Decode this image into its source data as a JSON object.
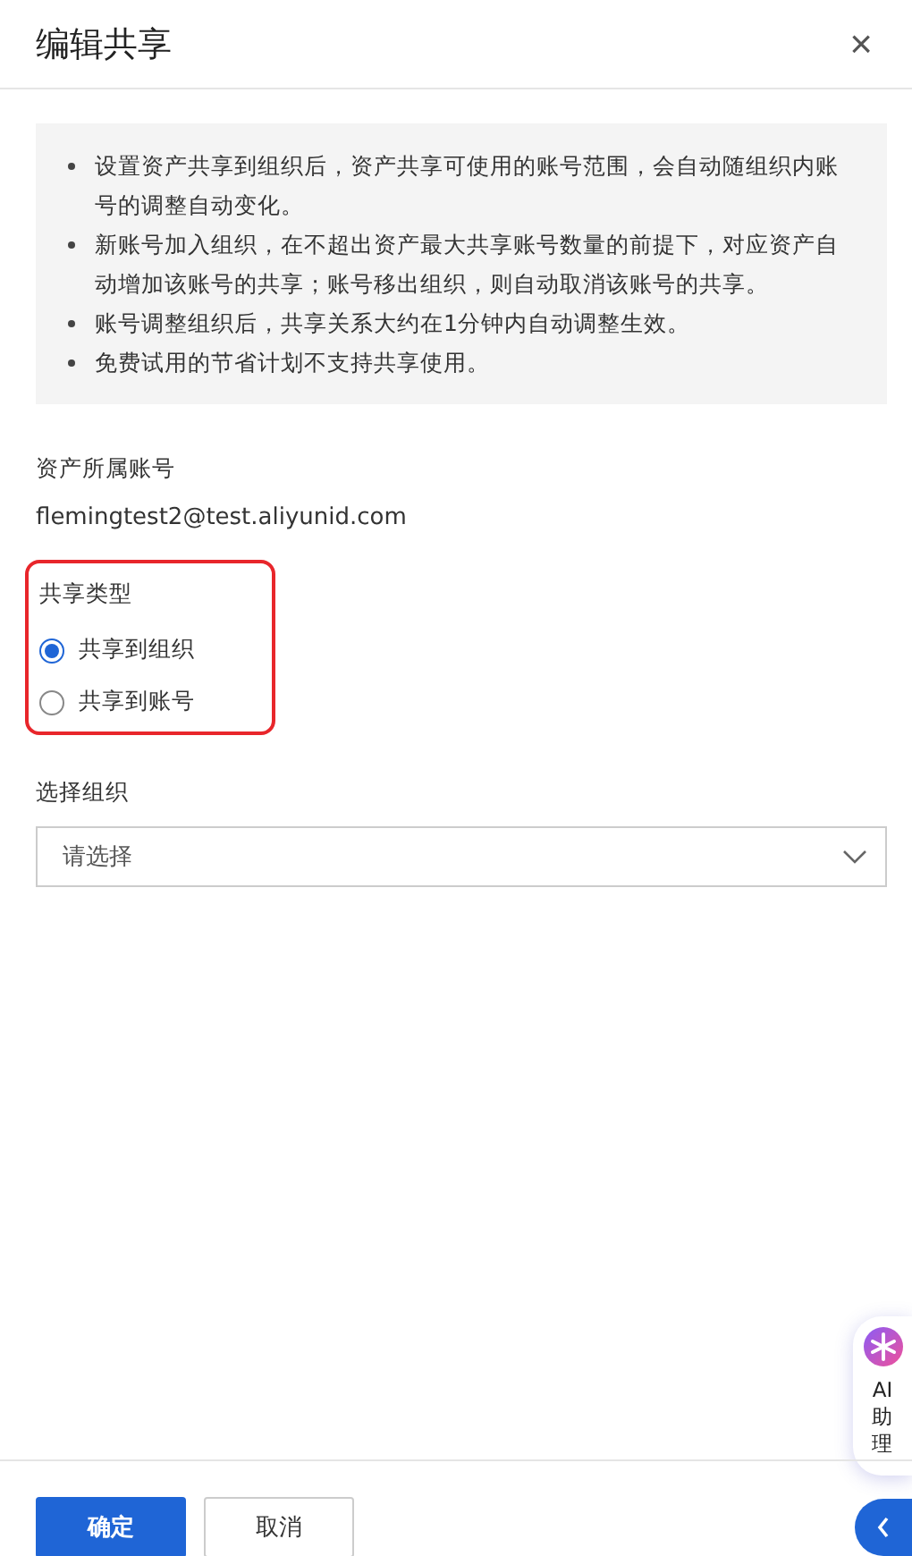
{
  "dialog": {
    "title": "编辑共享",
    "close": "×"
  },
  "notice": {
    "items": [
      "设置资产共享到组织后，资产共享可使用的账号范围，会自动随组织内账号的调整自动变化。",
      "新账号加入组织，在不超出资产最大共享账号数量的前提下，对应资产自动增加该账号的共享；账号移出组织，则自动取消该账号的共享。",
      "账号调整组织后，共享关系大约在1分钟内自动调整生效。",
      "免费试用的节省计划不支持共享使用。"
    ]
  },
  "account": {
    "label": "资产所属账号",
    "value": "flemingtest2@test.aliyunid.com"
  },
  "share_type": {
    "label": "共享类型",
    "options": [
      {
        "label": "共享到组织",
        "selected": true
      },
      {
        "label": "共享到账号",
        "selected": false
      }
    ]
  },
  "organization": {
    "label": "选择组织",
    "placeholder": "请选择"
  },
  "assistant": {
    "label": "AI助理"
  },
  "buttons": [
    {
      "label": "确定",
      "kind": "primary"
    },
    {
      "label": "取消",
      "kind": "secondary"
    }
  ]
}
